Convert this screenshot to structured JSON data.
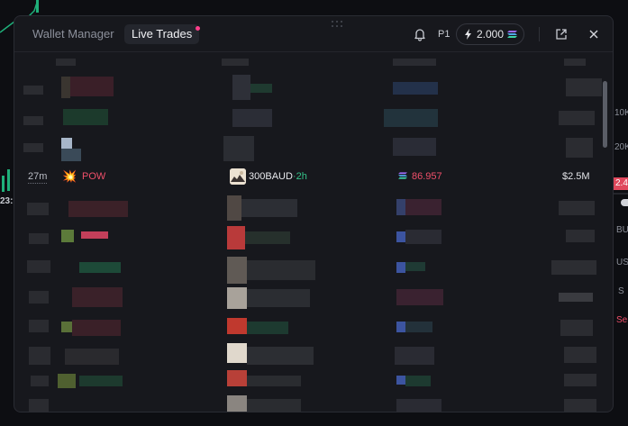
{
  "background": {
    "axis_labels": [
      "10K",
      "20K",
      "23:",
      "2.4",
      "BU",
      "US",
      "S",
      "Se"
    ]
  },
  "header": {
    "tabs": [
      {
        "label": "Wallet Manager",
        "active": false
      },
      {
        "label": "Live Trades",
        "active": true,
        "notification_dot": true
      }
    ],
    "bell_icon": "bell-icon",
    "preset_label": "P1",
    "balance": {
      "icon": "lightning-icon",
      "value": "2.000",
      "currency_icon": "solana-icon"
    },
    "external_icon": "external-link-icon",
    "close_icon": "close-icon"
  },
  "featured_trade": {
    "time": "27m",
    "token_emoji": "💥",
    "token": "POW",
    "trader": "300BAUD",
    "trader_age": "·2h",
    "amount": "86.957",
    "market_cap": "$2.5M"
  },
  "colors": {
    "panel_bg": "#17181d",
    "sell_red": "#f04f6a",
    "buy_green": "#35c48a",
    "accent_pink": "#ff3e8a"
  }
}
